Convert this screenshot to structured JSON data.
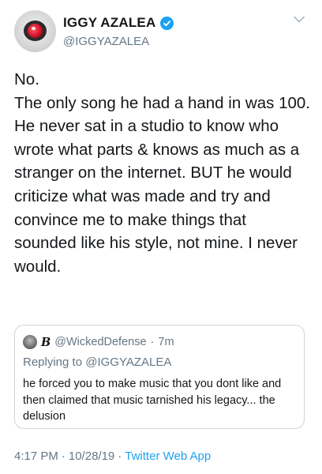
{
  "author": {
    "display_name": "IGGY AZALEA",
    "handle": "@IGGYAZALEA",
    "verified": true
  },
  "tweet": {
    "text": "No.\nThe only song he had a hand in was 100. He never sat in a studio to know who wrote what parts & knows as much as a stranger on the internet. BUT he would criticize what was made and try and convince me to make things that sounded like his style, not mine. I never would."
  },
  "quoted_tweet": {
    "name": "B",
    "handle": "@WickedDefense",
    "separator": "·",
    "time": "7m",
    "replying_prefix": "Replying to",
    "replying_to": "@IGGYAZALEA",
    "text": "he forced you to make music that you dont like and then claimed that music tarnished his legacy... the delusion"
  },
  "meta": {
    "time": "4:17 PM",
    "separator1": "·",
    "date": "10/28/19",
    "separator2": "·",
    "source": "Twitter Web App"
  },
  "colors": {
    "text": "#14171a",
    "secondary": "#657786",
    "accent": "#1da1f2",
    "border": "#ccd6dd"
  },
  "icons": {
    "verified": "verified-badge-icon",
    "menu": "chevron-down-icon"
  }
}
